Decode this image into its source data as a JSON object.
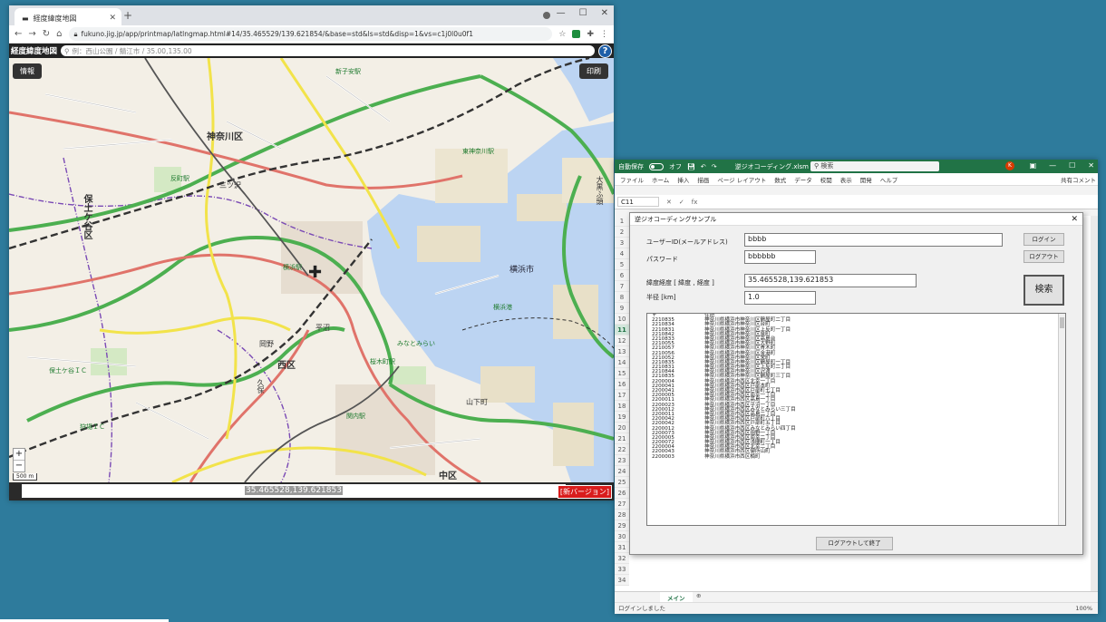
{
  "browser": {
    "tab_title": "経度緯度地図",
    "url": "fukuno.jig.jp/app/printmap/latlngmap.html#14/35.465529/139.621854/&base=std&ls=std&disp=1&vs=c1j0l0u0f1",
    "site_title": "経度緯度地図",
    "search_placeholder": "例：西山公園 / 鯖江市 / 35.00,135.00",
    "info_button": "情報",
    "print_button": "印刷",
    "coord_value": "35.465528,139.621853",
    "new_version": "[新バージョン]",
    "scale": "500 m",
    "map_labels": {
      "kanagawa_ku": "神奈川区",
      "hodogaya_ku": "保土ケ谷区",
      "nishi_ku": "西区",
      "naka_ku": "中区",
      "yokohama_shi": "横浜市",
      "mitsuzawa": "三ツ沢",
      "okano": "岡野",
      "kubo": "久保",
      "hodogaya_ic": "保土ケ谷ＩＣ",
      "kariba_ic": "狩場ＩＣ",
      "hiranuma": "平沼",
      "yokohama_station": "横浜駅",
      "higashi_kanagawa": "東神奈川駅",
      "sakuragicho": "桜木町駅",
      "kannai": "関内駅",
      "minatomirai": "みなとみらい",
      "yamashita": "山下町",
      "port": "横浜港",
      "shinkoyasu": "新子安駅",
      "tammachi": "反町駅",
      "daikoku": "大黒ふ頭"
    }
  },
  "excel": {
    "autosave": "自動保存",
    "autosave_state": "オフ",
    "filename": "逆ジオコーディング.xlsm",
    "search": "検索",
    "avatar": "K",
    "menu": [
      "ファイル",
      "ホーム",
      "挿入",
      "描画",
      "ページ レイアウト",
      "数式",
      "データ",
      "校閲",
      "表示",
      "開発",
      "ヘルプ"
    ],
    "share": "共有",
    "comment": "コメント",
    "namebox": "C11",
    "fx": "fx",
    "rows": [
      "1",
      "2",
      "3",
      "4",
      "5",
      "6",
      "7",
      "8",
      "9",
      "10",
      "11",
      "12",
      "13",
      "14",
      "15",
      "16",
      "17",
      "18",
      "19",
      "20",
      "21",
      "22",
      "23",
      "24",
      "25",
      "26",
      "27",
      "28",
      "29",
      "30",
      "31",
      "32",
      "33",
      "34"
    ],
    "sheet_tab": "メイン",
    "status": "ログインしました",
    "zoom": "100%"
  },
  "userform": {
    "title": "逆ジオコーディングサンプル",
    "user_label": "ユーザーID(メールアドレス)",
    "user_value": "bbbb",
    "password_label": "パスワード",
    "password_value": "bbbbbb",
    "latlng_label": "緯度経度 [ 緯度 , 経度 ]",
    "latlng_value": "35.465528,139.621853",
    "radius_label": "半径 [km]",
    "radius_value": "1.0",
    "login_button": "ログイン",
    "logout_button": "ログアウト",
    "search_button": "検索",
    "exit_button": "ログアウトして終了",
    "list_header": {
      "zip": "〒",
      "address": "住所"
    },
    "results": [
      {
        "zip": "2210835",
        "address": "神奈川県横浜市神奈川区鶴屋町二丁目"
      },
      {
        "zip": "2210834",
        "address": "神奈川県横浜市神奈川区台町"
      },
      {
        "zip": "2210831",
        "address": "神奈川県横浜市神奈川区上反町一丁目"
      },
      {
        "zip": "2210842",
        "address": "神奈川県横浜市神奈川区泉町"
      },
      {
        "zip": "2210833",
        "address": "神奈川県横浜市神奈川区高島台"
      },
      {
        "zip": "2210055",
        "address": "神奈川県横浜市神奈川区大野町"
      },
      {
        "zip": "2210057",
        "address": "神奈川県横浜市神奈川区青木町"
      },
      {
        "zip": "2210056",
        "address": "神奈川県横浜市神奈川区金港町"
      },
      {
        "zip": "2210052",
        "address": "神奈川県横浜市神奈川区栄町"
      },
      {
        "zip": "2210835",
        "address": "神奈川県横浜市神奈川区鶴屋町一丁目"
      },
      {
        "zip": "2210831",
        "address": "神奈川県横浜市神奈川区上反町二丁目"
      },
      {
        "zip": "2210844",
        "address": "神奈川県横浜市神奈川区沢渡"
      },
      {
        "zip": "2210835",
        "address": "神奈川県横浜市神奈川区鶴屋町三丁目"
      },
      {
        "zip": "2200004",
        "address": "神奈川県横浜市西区北幸一丁目"
      },
      {
        "zip": "2200041",
        "address": "神奈川県横浜市西区戸部本町"
      },
      {
        "zip": "2200041",
        "address": "神奈川県横浜市西区戸部町七丁目"
      },
      {
        "zip": "2200005",
        "address": "神奈川県横浜市西区南幸一丁目"
      },
      {
        "zip": "2200011",
        "address": "神奈川県横浜市西区高島一丁目"
      },
      {
        "zip": "2200023",
        "address": "神奈川県横浜市西区平沼一丁目"
      },
      {
        "zip": "2200012",
        "address": "神奈川県横浜市西区みなとみらい三丁目"
      },
      {
        "zip": "2200011",
        "address": "神奈川県横浜市西区高島二丁目"
      },
      {
        "zip": "2200042",
        "address": "神奈川県横浜市西区戸部町六丁目"
      },
      {
        "zip": "2200042",
        "address": "神奈川県横浜市西区戸部町五丁目"
      },
      {
        "zip": "2200012",
        "address": "神奈川県横浜市西区みなとみらい四丁目"
      },
      {
        "zip": "2200073",
        "address": "神奈川県横浜市西区岡野一丁目"
      },
      {
        "zip": "2200005",
        "address": "神奈川県横浜市西区南幸二丁目"
      },
      {
        "zip": "2200072",
        "address": "神奈川県横浜市西区浅間町一丁目"
      },
      {
        "zip": "2200004",
        "address": "神奈川県横浜市西区北幸二丁目"
      },
      {
        "zip": "2200043",
        "address": "神奈川県横浜市西区御所山町"
      },
      {
        "zip": "2200003",
        "address": "神奈川県横浜市西区楠町"
      }
    ]
  },
  "colors": {
    "desktop": "#2e7b9c",
    "excel_green": "#217346",
    "sea": "#bcd4f2",
    "expressway": "#4caf50",
    "national_road": "#e0736a",
    "prefectural_road": "#f2e34a"
  }
}
